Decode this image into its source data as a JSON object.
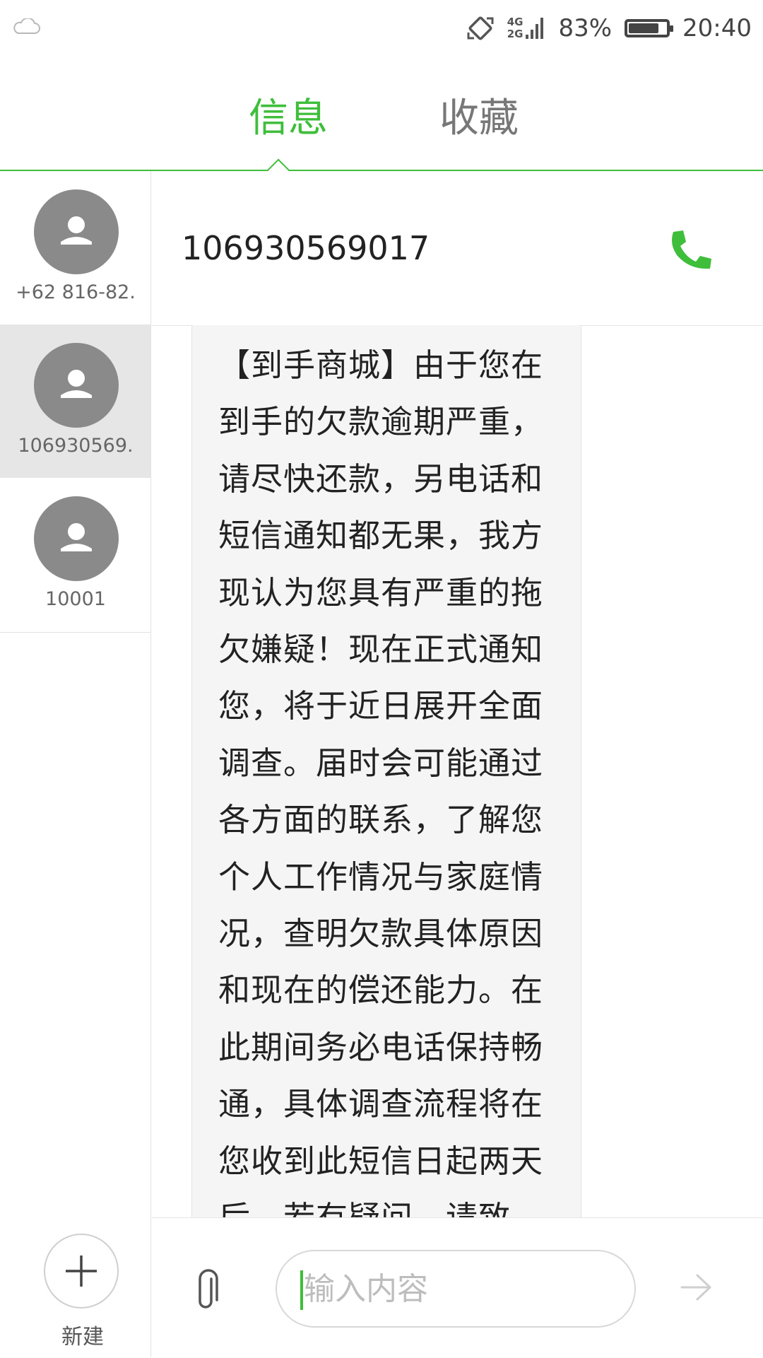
{
  "status_bar": {
    "network_top": "4G",
    "network_bottom": "2G",
    "battery_level": 0.83,
    "battery_text": "83%",
    "time": "20:40"
  },
  "tabs": [
    {
      "label": "信息",
      "active": true
    },
    {
      "label": "收藏",
      "active": false
    }
  ],
  "contacts": [
    {
      "name": "+62 816-82.",
      "selected": false
    },
    {
      "name": "106930569.",
      "selected": true
    },
    {
      "name": "10001",
      "selected": false
    }
  ],
  "new_button": {
    "label": "新建"
  },
  "conversation": {
    "number": "106930569017",
    "messages": [
      {
        "text": "【到手商城】由于您在到手的欠款逾期严重，请尽快还款，另电话和短信通知都无果，我方现认为您具有严重的拖欠嫌疑！现在正式通知您，将于近日展开全面调查。届时会可能通过各方面的联系，了解您个人工作情况与家庭情况，查明欠款具体原因和现在的偿还能力。在此期间务必电话保持畅通，具体调查流程将在您收到此短信日起两天后。若有疑问，请致"
      }
    ]
  },
  "composer": {
    "placeholder": "输入内容",
    "value": ""
  },
  "colors": {
    "accent": "#3fbe3b",
    "bubble": "#f5f5f5",
    "avatar": "#8a8a8a",
    "selected_row": "#e6e6e6"
  },
  "icons": [
    "cloud-icon",
    "rotation-lock-icon",
    "signal-icon",
    "battery-icon",
    "phone-icon",
    "person-icon",
    "plus-icon",
    "paperclip-icon",
    "send-arrow-icon"
  ]
}
